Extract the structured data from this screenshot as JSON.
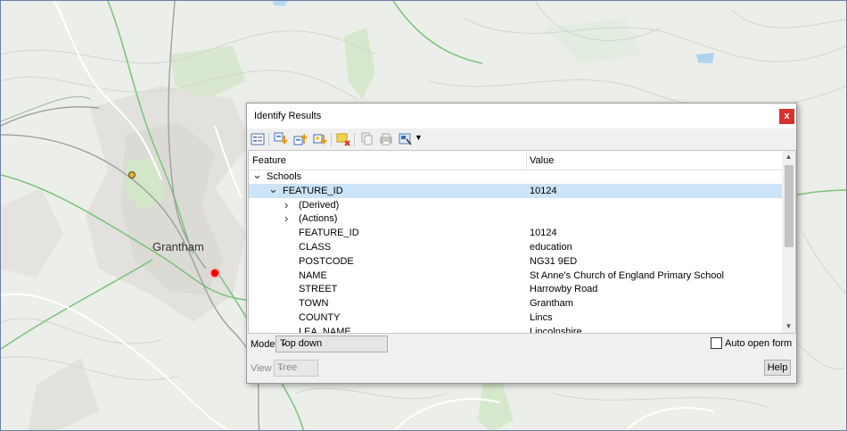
{
  "map": {
    "place_label": "Grantham"
  },
  "dialog": {
    "title": "Identify Results",
    "close_glyph": "x",
    "toolbar_icons": [
      "expand-icon",
      "expand-all-icon",
      "collapse-all-icon",
      "expand-new-icon",
      "clear-results-icon",
      "copy-icon",
      "print-icon",
      "select-icon",
      "dropdown-arrow-icon"
    ],
    "columns": [
      "Feature",
      "Value"
    ],
    "rows": [
      {
        "level": 0,
        "arrow": "down",
        "feature": "Schools",
        "value": ""
      },
      {
        "level": 1,
        "arrow": "down",
        "feature": "FEATURE_ID",
        "value": "10124",
        "selected": true
      },
      {
        "level": 2,
        "arrow": "right",
        "feature": "(Derived)",
        "value": ""
      },
      {
        "level": 2,
        "arrow": "right",
        "feature": "(Actions)",
        "value": ""
      },
      {
        "level": 2,
        "arrow": "",
        "feature": "FEATURE_ID",
        "value": "10124"
      },
      {
        "level": 2,
        "arrow": "",
        "feature": "CLASS",
        "value": "education"
      },
      {
        "level": 2,
        "arrow": "",
        "feature": "POSTCODE",
        "value": "NG31 9ED"
      },
      {
        "level": 2,
        "arrow": "",
        "feature": "NAME",
        "value": "St Anne's Church of England Primary School"
      },
      {
        "level": 2,
        "arrow": "",
        "feature": "STREET",
        "value": "Harrowby Road"
      },
      {
        "level": 2,
        "arrow": "",
        "feature": "TOWN",
        "value": "Grantham"
      },
      {
        "level": 2,
        "arrow": "",
        "feature": "COUNTY",
        "value": "Lincs"
      },
      {
        "level": 2,
        "arrow": "",
        "feature": "LEA_NAME",
        "value": "Lincolnshire"
      }
    ],
    "mode_label": "Mode",
    "mode_value": "Top down",
    "auto_open_label": "Auto open form",
    "auto_open_checked": false,
    "view_label": "View",
    "view_value": "Tree",
    "help_label": "Help"
  }
}
